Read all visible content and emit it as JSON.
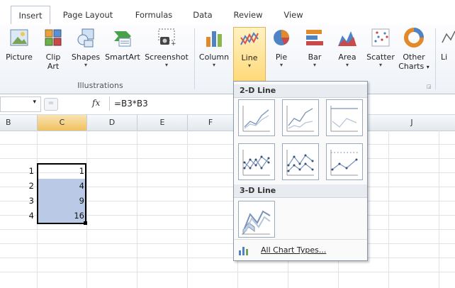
{
  "tabs": [
    {
      "label": "Insert",
      "active": true
    },
    {
      "label": "Page Layout"
    },
    {
      "label": "Formulas"
    },
    {
      "label": "Data"
    },
    {
      "label": "Review"
    },
    {
      "label": "View"
    }
  ],
  "ribbon": {
    "picture": "Picture",
    "clip_art": [
      "Clip",
      "Art"
    ],
    "shapes": "Shapes",
    "smartart": "SmartArt",
    "screenshot": "Screenshot",
    "illustrations_group": "Illustrations",
    "column": "Column",
    "line": "Line",
    "pie": "Pie",
    "bar": "Bar",
    "area": "Area",
    "scatter": "Scatter",
    "other_charts": [
      "Other",
      "Charts"
    ],
    "cut_off": "Li"
  },
  "formula_bar": {
    "fx": "fx",
    "formula": "=B3*B3"
  },
  "columns": [
    "B",
    "C",
    "D",
    "E",
    "F",
    "J"
  ],
  "active_column": "C",
  "cells": {
    "b_values": [
      "1",
      "2",
      "3",
      "4"
    ],
    "c_values": [
      "1",
      "4",
      "9",
      "16"
    ]
  },
  "line_menu": {
    "section_2d": "2-D Line",
    "section_3d": "3-D Line",
    "all_chart_types": "All Chart Types..."
  },
  "colors": {
    "selection_fill": "#b9c9e6",
    "highlight": "#ffd978",
    "header_active": "#f1c15f"
  }
}
